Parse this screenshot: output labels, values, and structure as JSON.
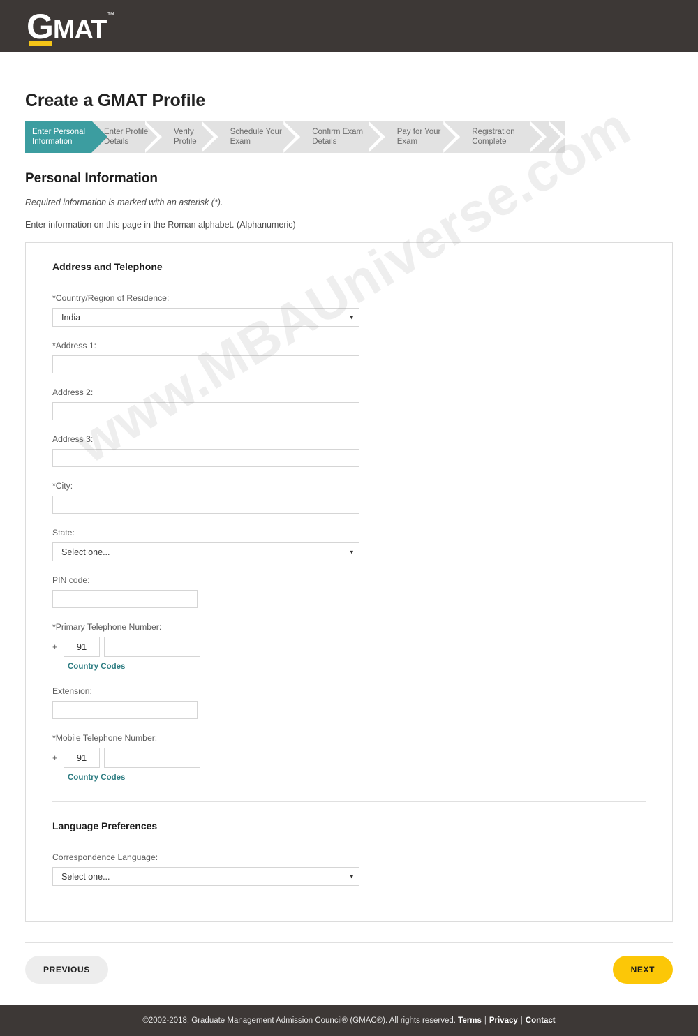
{
  "header": {
    "logo_main": "G",
    "logo_rest": "MAT",
    "logo_tm": "™"
  },
  "page": {
    "title": "Create a GMAT Profile",
    "section_title": "Personal Information",
    "note_italic": "Required information is marked with an asterisk (*).",
    "note_plain": "Enter information on this page in the Roman alphabet. (Alphanumeric)"
  },
  "stepper": {
    "steps": [
      {
        "label": "Enter Personal Information",
        "active": true
      },
      {
        "label": "Enter Profile Details",
        "active": false
      },
      {
        "label": "Verify Profile",
        "active": false
      },
      {
        "label": "Schedule Your Exam",
        "active": false
      },
      {
        "label": "Confirm Exam Details",
        "active": false
      },
      {
        "label": "Pay for Your Exam",
        "active": false
      },
      {
        "label": "Registration Complete",
        "active": false
      }
    ],
    "active_color": "#3c9da0",
    "inactive_color": "#e2e2e2"
  },
  "card": {
    "address_section_heading": "Address and Telephone",
    "language_section_heading": "Language Preferences",
    "fields": {
      "country": {
        "label": "*Country/Region of Residence:",
        "value": "India"
      },
      "address1": {
        "label": "*Address 1:",
        "value": "",
        "placeholder": ""
      },
      "address2": {
        "label": "Address 2:",
        "value": "",
        "placeholder": ""
      },
      "address3": {
        "label": "Address 3:",
        "value": "",
        "placeholder": ""
      },
      "city": {
        "label": "*City:",
        "value": "",
        "placeholder": ""
      },
      "state": {
        "label": "State:",
        "value": "Select one..."
      },
      "pin": {
        "label": "PIN code:",
        "value": "",
        "placeholder": ""
      },
      "primary_phone": {
        "label": "*Primary Telephone Number:",
        "plus": "+",
        "country_code": "91",
        "number": "",
        "link": "Country Codes"
      },
      "extension": {
        "label": "Extension:",
        "value": "",
        "placeholder": ""
      },
      "mobile_phone": {
        "label": "*Mobile Telephone Number:",
        "plus": "+",
        "country_code": "91",
        "number": "",
        "link": "Country Codes"
      },
      "correspondence_language": {
        "label": "Correspondence Language:",
        "value": "Select one..."
      }
    },
    "caret": "▾"
  },
  "nav": {
    "previous": "PREVIOUS",
    "next": "NEXT",
    "previous_color": "#ededed",
    "next_color": "#fcc707"
  },
  "footer": {
    "copyright": "©2002-2018, Graduate Management Admission Council® (GMAC®). All rights reserved.",
    "terms": "Terms",
    "privacy": "Privacy",
    "contact": "Contact",
    "pipe": "|"
  },
  "watermark": {
    "text": "www.MBAUniverse.com"
  }
}
